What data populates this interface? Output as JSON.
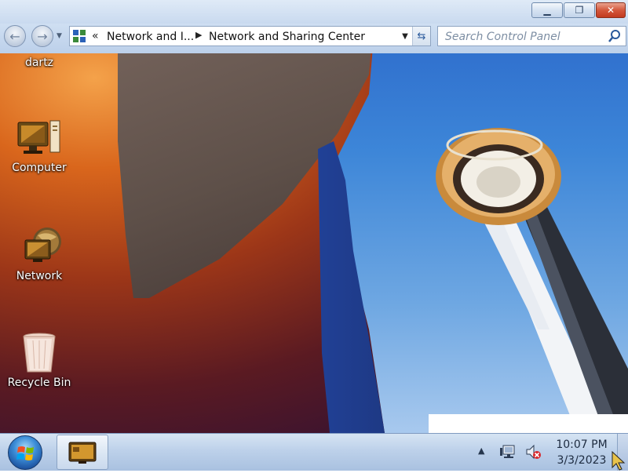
{
  "explorer": {
    "address": {
      "overflow_chevron": "«",
      "segments": [
        "Network and I...",
        "Network and Sharing Center"
      ]
    },
    "search": {
      "placeholder": "Search Control Panel"
    }
  },
  "desktop": {
    "icons": [
      {
        "label": "dartz"
      },
      {
        "label": "Computer"
      },
      {
        "label": "Network"
      },
      {
        "label": "Recycle Bin"
      }
    ]
  },
  "taskbar": {
    "clock": {
      "time": "10:07 PM",
      "date": "3/3/2023"
    }
  },
  "icons": {
    "back": "back-arrow-icon",
    "forward": "forward-arrow-icon",
    "refresh": "refresh-icon",
    "search": "magnifier-icon",
    "start": "windows-logo-icon",
    "network_tray": "network-icon",
    "volume_tray": "speaker-muted-icon"
  },
  "colors": {
    "titlebar": "#dfeaf7",
    "close_button": "#c23a1f",
    "taskbar": "#bdd1ea"
  }
}
